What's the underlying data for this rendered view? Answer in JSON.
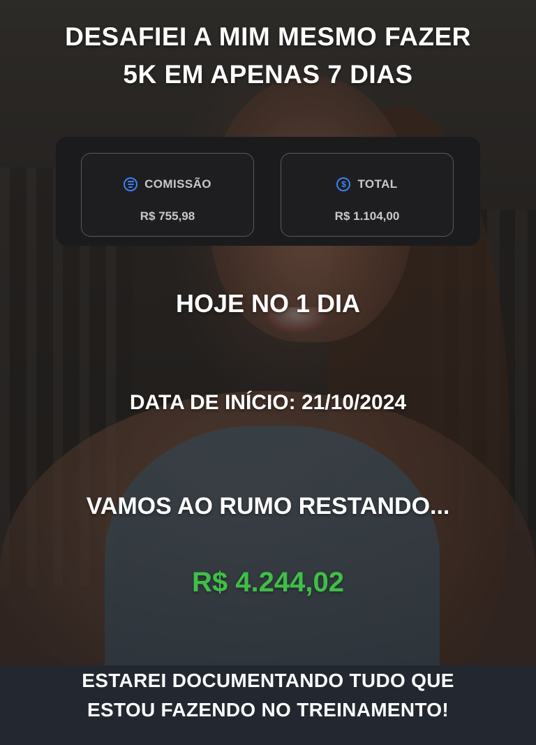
{
  "headline": {
    "line1": "DESAFIEI A MIM MESMO FAZER",
    "line2": "5K EM APENAS 7 DIAS"
  },
  "stats": {
    "commission": {
      "icon": "document-icon",
      "label": "COMISSÃO",
      "value": "R$ 755,98"
    },
    "total": {
      "icon": "dollar-icon",
      "label": "TOTAL",
      "value": "R$ 1.104,00"
    },
    "accent_color": "#3b82f6"
  },
  "progress": {
    "day_text": "HOJE NO 1 DIA",
    "start_text": "DATA DE INÍCIO: 21/10/2024",
    "remaining_text": "VAMOS AO RUMO RESTANDO...",
    "remaining_amount": "R$ 4.244,02",
    "remaining_color": "#3fbf48"
  },
  "footer": {
    "line1": "ESTAREI DOCUMENTANDO TUDO QUE",
    "line2": "ESTOU FAZENDO NO TREINAMENTO!"
  }
}
